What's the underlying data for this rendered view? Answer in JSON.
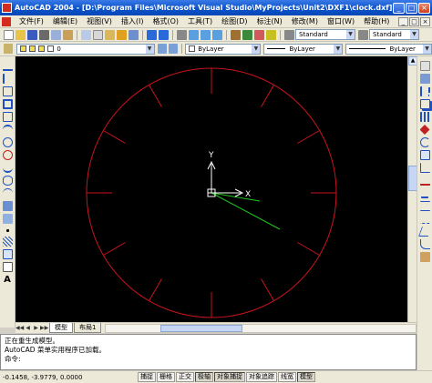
{
  "window": {
    "title": "AutoCAD 2004 - [D:\\Program Files\\Microsoft Visual Studio\\MyProjects\\Unit2\\DXF1\\clock.dxf]",
    "controls": [
      "_",
      "□",
      "×"
    ]
  },
  "menubar": {
    "items": [
      "文件(F)",
      "编辑(E)",
      "视图(V)",
      "插入(I)",
      "格式(O)",
      "工具(T)",
      "绘图(D)",
      "标注(N)",
      "修改(M)",
      "窗口(W)",
      "帮助(H)"
    ],
    "doc_controls": [
      "_",
      "□",
      "×"
    ]
  },
  "toolbar": {
    "text_style": "Standard",
    "dim_style": "Standard",
    "layer": "0",
    "color": "ByLayer",
    "linetype": "ByLayer",
    "lineweight": "ByLayer"
  },
  "tabs": {
    "model": "模型",
    "layout": "布局1",
    "nav": [
      "◀◀",
      "◀",
      "▶",
      "▶▶"
    ]
  },
  "ucs": {
    "x_label": "X",
    "y_label": "Y"
  },
  "command": {
    "lines": [
      "正在重生成模型。",
      "AutoCAD 菜单实用程序已加载。"
    ],
    "prompt": "命令:"
  },
  "status": {
    "coordinates": "-0.1458, -3.9779, 0.0000",
    "buttons": [
      "捕捉",
      "栅格",
      "正交",
      "极轴",
      "对象捕捉",
      "对象追踪",
      "线宽",
      "模型"
    ]
  },
  "colors": {
    "clock_face": "#c8141e",
    "hands": "#1ec81e",
    "ucs": "#ffffff",
    "title_bar": "#0a52c9"
  }
}
